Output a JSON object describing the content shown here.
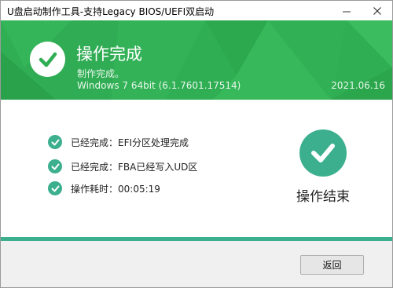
{
  "window": {
    "title": "U盘启动制作工具-支持Legacy BIOS/UEFI双启动",
    "minimize_icon": "minimize-icon",
    "close_icon": "close-icon"
  },
  "banner": {
    "title": "操作完成",
    "subtitle": "制作完成。",
    "os_info": "Windows 7 64bit (6.1.7601.17514)",
    "date": "2021.06.16",
    "icon": "check-circle-icon",
    "color": "#2fae53"
  },
  "status_items": [
    {
      "text": "已经完成：EFI分区处理完成",
      "icon": "check-circle-icon"
    },
    {
      "text": "已经完成：FBA已经写入UD区",
      "icon": "check-circle-icon"
    },
    {
      "text": "操作耗时：00:05:19",
      "icon": "check-circle-icon"
    }
  ],
  "result": {
    "label": "操作结束",
    "icon": "check-circle-icon",
    "color": "#3caf8e"
  },
  "footer": {
    "back_label": "返回"
  }
}
